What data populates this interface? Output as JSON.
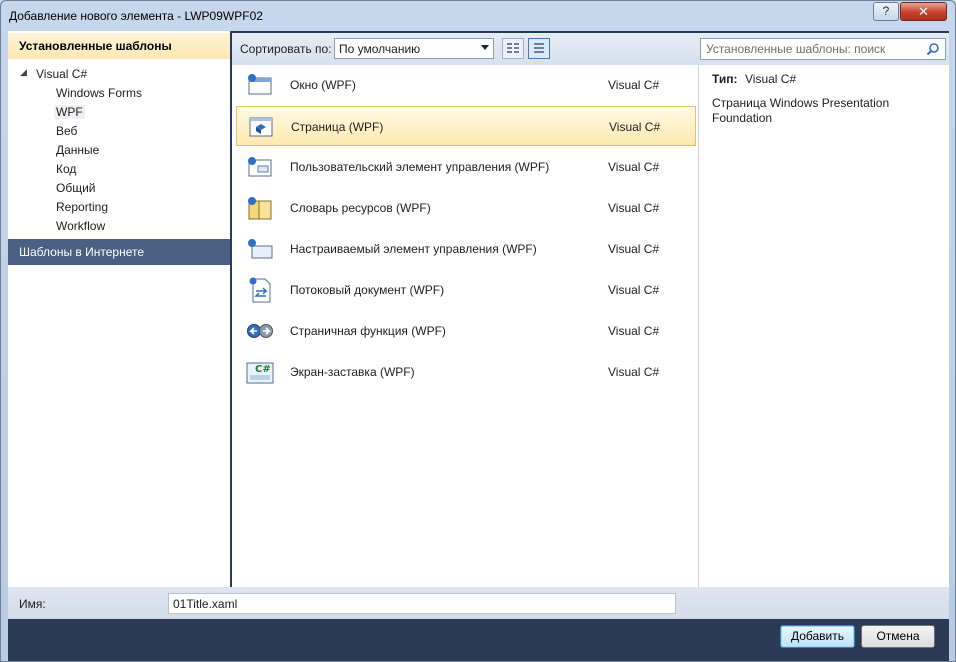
{
  "window": {
    "title": "Добавление нового элемента - LWP09WPF02",
    "help_glyph": "?",
    "close_glyph": "✕"
  },
  "sidebar": {
    "installed_header": "Установленные шаблоны",
    "root": {
      "label": "Visual C#",
      "expanded": true
    },
    "items": [
      {
        "label": "Windows Forms"
      },
      {
        "label": "WPF",
        "selected": true
      },
      {
        "label": "Веб"
      },
      {
        "label": "Данные"
      },
      {
        "label": "Код"
      },
      {
        "label": "Общий"
      },
      {
        "label": "Reporting"
      },
      {
        "label": "Workflow"
      }
    ],
    "online_header": "Шаблоны в Интернете"
  },
  "toolbar": {
    "sort_label": "Сортировать по:",
    "sort_value": "По умолчанию"
  },
  "templates": [
    {
      "name": "Окно (WPF)",
      "lang": "Visual C#",
      "icon": "window-icon"
    },
    {
      "name": "Страница (WPF)",
      "lang": "Visual C#",
      "icon": "page-icon",
      "selected": true
    },
    {
      "name": "Пользовательский элемент управления (WPF)",
      "lang": "Visual C#",
      "icon": "user-control-icon"
    },
    {
      "name": "Словарь ресурсов (WPF)",
      "lang": "Visual C#",
      "icon": "resource-dictionary-icon"
    },
    {
      "name": "Настраиваемый элемент управления (WPF)",
      "lang": "Visual C#",
      "icon": "custom-control-icon"
    },
    {
      "name": "Потоковый документ (WPF)",
      "lang": "Visual C#",
      "icon": "flow-document-icon"
    },
    {
      "name": "Страничная функция (WPF)",
      "lang": "Visual C#",
      "icon": "page-function-icon"
    },
    {
      "name": "Экран-заставка (WPF)",
      "lang": "Visual C#",
      "icon": "splash-screen-icon"
    }
  ],
  "search": {
    "placeholder": "Установленные шаблоны: поиск"
  },
  "details": {
    "type_label": "Тип:",
    "type_value": "Visual C#",
    "description": "Страница Windows Presentation Foundation"
  },
  "name_field": {
    "label": "Имя:",
    "value": "01Title.xaml"
  },
  "buttons": {
    "add": "Добавить",
    "cancel": "Отмена"
  }
}
